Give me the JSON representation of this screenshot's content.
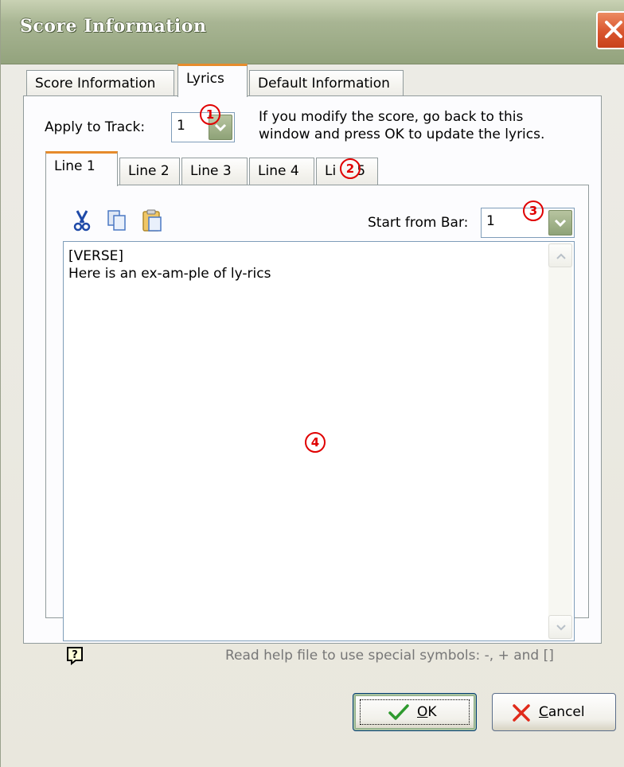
{
  "window": {
    "title": "Score Information",
    "close_icon": "close-icon"
  },
  "outer_tabs": [
    {
      "label": "Score Information",
      "active": false
    },
    {
      "label": "Lyrics",
      "active": true
    },
    {
      "label": "Default Information",
      "active": false
    }
  ],
  "apply": {
    "label": "Apply to Track:",
    "value": "1"
  },
  "info_text": {
    "line1": "If you modify the score, go back to this",
    "line2": "window and press OK to update the lyrics."
  },
  "inner_tabs": [
    {
      "label": "Line 1",
      "active": true
    },
    {
      "label": "Line 2",
      "active": false
    },
    {
      "label": "Line 3",
      "active": false
    },
    {
      "label": "Line 4",
      "active": false
    },
    {
      "label": "Li",
      "active": false
    },
    {
      "label": "5",
      "active": false
    }
  ],
  "toolbar": {
    "cut_icon": "scissors-icon",
    "copy_icon": "copy-icon",
    "paste_icon": "paste-icon"
  },
  "start_bar": {
    "label": "Start from Bar:",
    "value": "1"
  },
  "editor": {
    "lines": [
      "[VERSE]",
      "Here is an ex-am-ple of ly-rics"
    ]
  },
  "help": {
    "icon": "help-icon",
    "text": "Read help file to use special symbols: -, + and []"
  },
  "markers": [
    "1",
    "2",
    "3",
    "4"
  ],
  "buttons": {
    "ok_underlined": "O",
    "ok_rest": "K",
    "cancel_underlined": "C",
    "cancel_rest": "ancel"
  },
  "colors": {
    "accent_tab": "#e68b2c",
    "marker": "#e00000",
    "close": "#d9542d"
  }
}
